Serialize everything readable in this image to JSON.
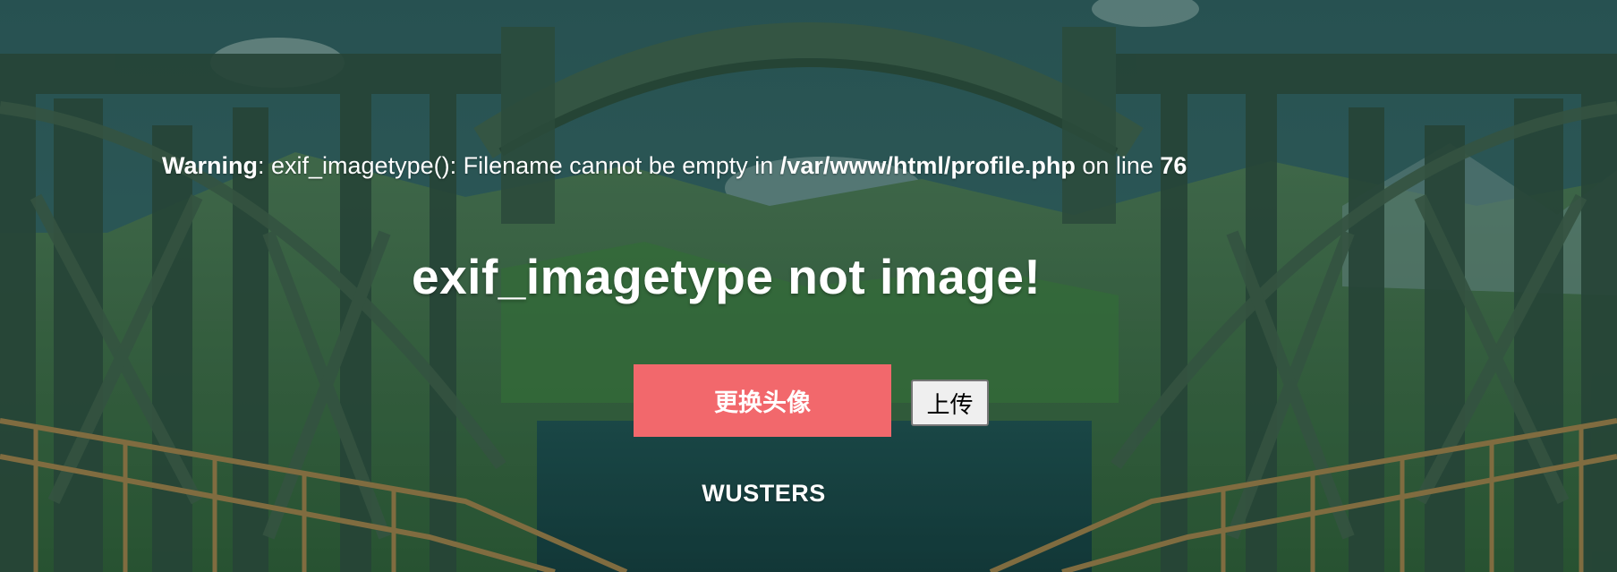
{
  "warning": {
    "label": "Warning",
    "message": ": exif_imagetype(): Filename cannot be empty in ",
    "file": "/var/www/html/profile.php",
    "line_text": " on line ",
    "line_number": "76"
  },
  "headline": "exif_imagetype not image!",
  "buttons": {
    "change_avatar": "更换头像",
    "upload": "上传"
  },
  "username": "WUSTERS",
  "colors": {
    "accent_button": "#f2686c",
    "text": "#ffffff"
  }
}
